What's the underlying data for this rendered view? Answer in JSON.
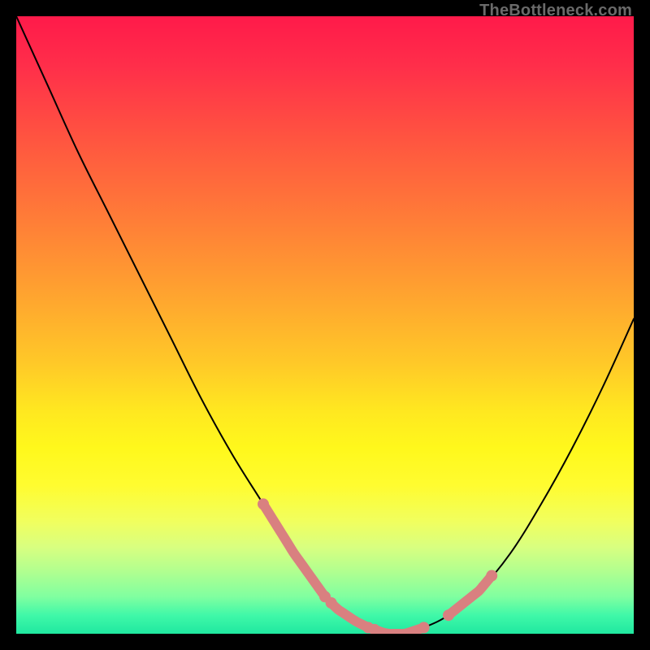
{
  "watermark": "TheBottleneck.com",
  "chart_data": {
    "type": "line",
    "title": "",
    "xlabel": "",
    "ylabel": "",
    "xlim": [
      0,
      100
    ],
    "ylim": [
      0,
      100
    ],
    "series": [
      {
        "name": "curve",
        "x": [
          0,
          5,
          10,
          15,
          20,
          25,
          30,
          35,
          40,
          45,
          50,
          52,
          55,
          57,
          60,
          63,
          66,
          70,
          75,
          80,
          85,
          90,
          95,
          100
        ],
        "y": [
          100,
          89,
          78,
          68,
          58,
          48,
          38,
          29,
          21,
          13,
          6,
          4,
          2,
          1,
          0,
          0,
          1,
          3,
          7,
          13,
          21,
          30,
          40,
          51
        ]
      }
    ],
    "highlight_segments": [
      {
        "from_x": 40,
        "to_x": 50
      },
      {
        "from_x": 51,
        "to_x": 57
      },
      {
        "from_x": 58,
        "to_x": 66
      },
      {
        "from_x": 70,
        "to_x": 77
      }
    ],
    "highlight_color": "#d98080",
    "curve_color": "#000000"
  }
}
